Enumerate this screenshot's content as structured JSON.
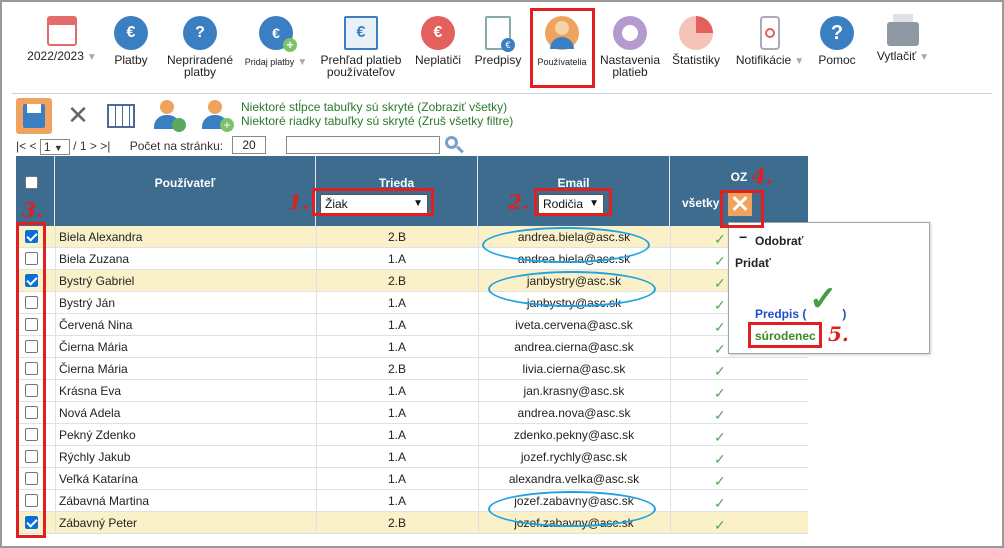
{
  "toolbar": [
    {
      "label": "2022/2023",
      "icon": "calendar-icon",
      "dropdown": true
    },
    {
      "label": "Platby",
      "icon": "money-bag-euro-icon"
    },
    {
      "label": "Nepriradené platby",
      "icon": "money-bag-question-icon"
    },
    {
      "label": "Pridaj platby",
      "icon": "money-bag-add-icon",
      "dropdown": true
    },
    {
      "label": "Prehľad platieb používateľov",
      "icon": "payments-overview-icon"
    },
    {
      "label": "Neplatiči",
      "icon": "money-bag-clock-icon"
    },
    {
      "label": "Predpisy",
      "icon": "document-euro-icon"
    },
    {
      "label": "Používatelia",
      "icon": "user-icon",
      "active": true
    },
    {
      "label": "Nastavenia platieb",
      "icon": "gear-icon"
    },
    {
      "label": "Štatistiky",
      "icon": "pie-chart-icon"
    },
    {
      "label": "Notifikácie",
      "icon": "phone-notification-icon",
      "dropdown": true
    },
    {
      "label": "Pomoc",
      "icon": "help-icon"
    },
    {
      "label": "Vytlačiť",
      "icon": "printer-icon",
      "dropdown": true
    }
  ],
  "hints": {
    "columns": "Niektoré stĺpce tabuľky sú skryté",
    "columns_link": "(Zobraziť všetky)",
    "rows": "Niektoré riadky tabuľky sú skryté",
    "rows_link": "(Zruš všetky filtre)"
  },
  "pager": {
    "nav_first": "|<",
    "nav_prev": "<",
    "page": "1",
    "of": "/ 1",
    "nav_next": ">",
    "nav_last": ">|",
    "per_page_label": "Počet na stránku:",
    "per_page_value": "20"
  },
  "table": {
    "headers": {
      "user": "Používateľ",
      "class": "Trieda",
      "email": "Email",
      "oz": "OZ",
      "oz_sub": "všetky"
    },
    "class_filter": "Žiak",
    "email_filter": "Rodičia",
    "rows": [
      {
        "name": "Biela Alexandra",
        "class": "2.B",
        "email": "andrea.biela@asc.sk",
        "checked": true
      },
      {
        "name": "Biela Zuzana",
        "class": "1.A",
        "email": "andrea.biela@asc.sk",
        "checked": false
      },
      {
        "name": "Bystrý Gabriel",
        "class": "2.B",
        "email": "janbystry@asc.sk",
        "checked": true
      },
      {
        "name": "Bystrý Ján",
        "class": "1.A",
        "email": "janbystry@asc.sk",
        "checked": false
      },
      {
        "name": "Červená Nina",
        "class": "1.A",
        "email": "iveta.cervena@asc.sk",
        "checked": false
      },
      {
        "name": "Čierna Mária",
        "class": "1.A",
        "email": "andrea.cierna@asc.sk",
        "checked": false
      },
      {
        "name": "Čierna Mária",
        "class": "2.B",
        "email": "livia.cierna@asc.sk",
        "checked": false
      },
      {
        "name": "Krásna Eva",
        "class": "1.A",
        "email": "jan.krasny@asc.sk",
        "checked": false
      },
      {
        "name": "Nová Adela",
        "class": "1.A",
        "email": "andrea.nova@asc.sk",
        "checked": false
      },
      {
        "name": "Pekný Zdenko",
        "class": "1.A",
        "email": "zdenko.pekny@asc.sk",
        "checked": false
      },
      {
        "name": "Rýchly Jakub",
        "class": "1.A",
        "email": "jozef.rychly@asc.sk",
        "checked": false
      },
      {
        "name": "Veľká Katarína",
        "class": "1.A",
        "email": "alexandra.velka@asc.sk",
        "checked": false
      },
      {
        "name": "Zábavná Martina",
        "class": "1.A",
        "email": "jozef.zabavny@asc.sk",
        "checked": false
      },
      {
        "name": "Zábavný Peter",
        "class": "2.B",
        "email": "jozef.zabavny@asc.sk",
        "checked": true
      }
    ]
  },
  "popup": {
    "remove": "Odobrať",
    "add": "Pridať",
    "predpis": "Predpis (",
    "predpis_close": ")",
    "sibling": "súrodenec"
  },
  "annotations": [
    "1.",
    "2.",
    "3.",
    "4.",
    "5."
  ],
  "colors": {
    "header": "#3d6c8e",
    "highlight_row": "#fbf1c8",
    "annotation_red": "#e02020",
    "oval_blue": "#1ea2e0",
    "hint_green": "#2a7a2a"
  }
}
